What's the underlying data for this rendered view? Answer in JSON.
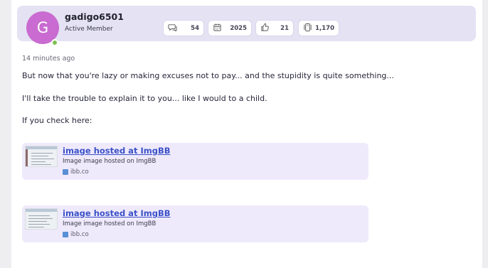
{
  "user": {
    "avatar_letter": "G",
    "username": "gadigo6501",
    "title": "Active Member",
    "online_color": "#7ec152",
    "avatar_color": "#c96bd0"
  },
  "stats": [
    {
      "icon": "messages-icon",
      "value": "54"
    },
    {
      "icon": "calendar-icon",
      "value": "2025"
    },
    {
      "icon": "thumbs-up-icon",
      "value": "21"
    },
    {
      "icon": "trophy-icon",
      "value": "1,170"
    }
  ],
  "post": {
    "timestamp": "14 minutes ago",
    "paragraphs": [
      "But now that you're lazy or making excuses not to pay... and the stupidity is quite something...",
      "I'll take the trouble to explain it to you... like I would to a child.",
      "If you check here:"
    ],
    "embeds": [
      {
        "title": "image hosted at ImgBB",
        "description": "Image image hosted on ImgBB",
        "domain": "ibb.co"
      },
      {
        "title": "image hosted at ImgBB",
        "description": "Image image hosted on ImgBB",
        "domain": "ibb.co"
      }
    ]
  },
  "colors": {
    "user_bar_bg": "#e4e2f3",
    "embed_bg": "#efeafb",
    "link": "#3b51c8"
  }
}
